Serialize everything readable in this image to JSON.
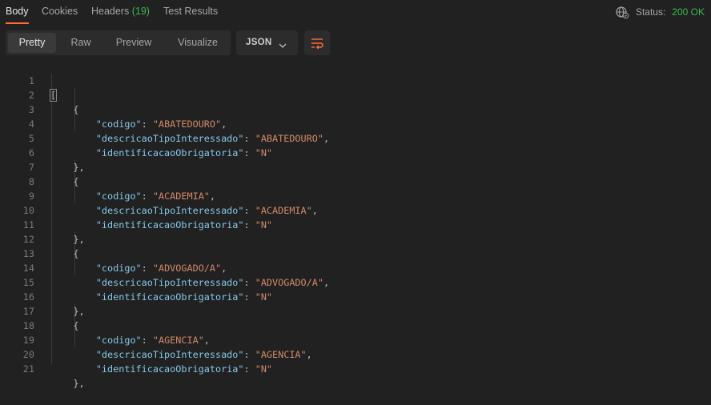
{
  "tabs": [
    {
      "label": "Body"
    },
    {
      "label": "Cookies"
    },
    {
      "label": "Headers",
      "count": "(19)"
    },
    {
      "label": "Test Results"
    }
  ],
  "status": {
    "label": "Status:",
    "value": "200 OK"
  },
  "colors": {
    "accent": "#ff6c37",
    "status_ok": "#3fb950",
    "key": "#86c7e8",
    "string": "#d3896a"
  },
  "view_modes": [
    "Pretty",
    "Raw",
    "Preview",
    "Visualize"
  ],
  "format": "JSON",
  "icons": {
    "globe": "globe-icon",
    "chevron": "chevron-down-icon",
    "wrap": "wrap-lines-icon"
  },
  "code": {
    "line_numbers": [
      "1",
      "2",
      "3",
      "4",
      "5",
      "6",
      "7",
      "8",
      "9",
      "10",
      "11",
      "12",
      "13",
      "14",
      "15",
      "16",
      "17",
      "18",
      "19",
      "20",
      "21"
    ],
    "open_array": "[",
    "open_obj": "{",
    "close_obj": "},",
    "keys": {
      "codigo": "\"codigo\"",
      "descricao": "\"descricaoTipoInteressado\"",
      "ident": "\"identificacaoObrigatoria\""
    },
    "records": [
      {
        "codigo": "\"ABATEDOURO\"",
        "descricao": "\"ABATEDOURO\"",
        "ident": "\"N\""
      },
      {
        "codigo": "\"ACADEMIA\"",
        "descricao": "\"ACADEMIA\"",
        "ident": "\"N\""
      },
      {
        "codigo": "\"ADVOGADO/A\"",
        "descricao": "\"ADVOGADO/A\"",
        "ident": "\"N\""
      },
      {
        "codigo": "\"AGENCIA\"",
        "descricao": "\"AGENCIA\"",
        "ident": "\"N\""
      }
    ]
  }
}
